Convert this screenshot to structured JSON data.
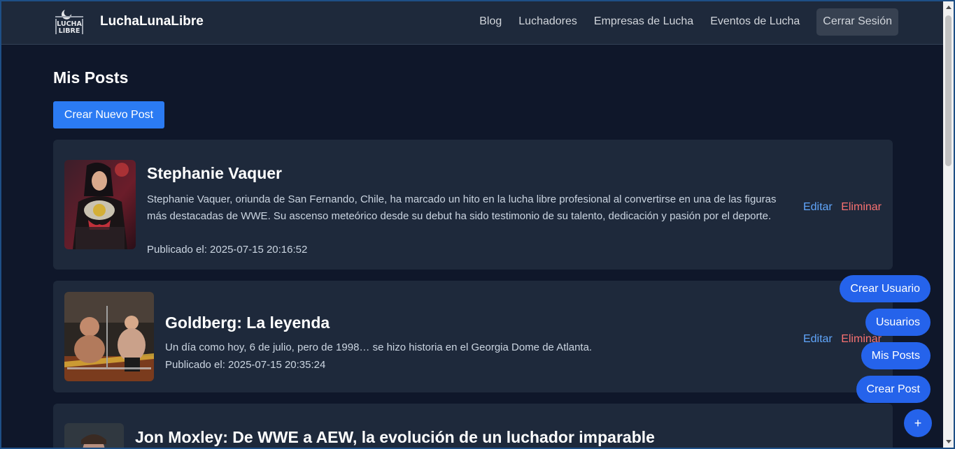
{
  "header": {
    "brand": "LuchaLunaLibre",
    "logo_text_top": "LUCHA",
    "logo_text_bottom": "LIBRE",
    "nav": [
      "Blog",
      "Luchadores",
      "Empresas de Lucha",
      "Eventos de Lucha"
    ],
    "logout": "Cerrar Sesión"
  },
  "main": {
    "title": "Mis Posts",
    "create_button": "Crear Nuevo Post",
    "posts": [
      {
        "title": "Stephanie Vaquer",
        "description": "Stephanie Vaquer, oriunda de San Fernando, Chile, ha marcado un hito en la lucha libre profesional al convertirse en una de las figuras más destacadas de WWE. Su ascenso meteórico desde su debut ha sido testimonio de su talento, dedicación y pasión por el deporte.",
        "date": "Publicado el: 2025-07-15 20:16:52",
        "edit": "Editar",
        "delete": "Eliminar"
      },
      {
        "title": "Goldberg: La leyenda",
        "description": "Un día como hoy, 6 de julio, pero de 1998… se hizo historia en el Georgia Dome de Atlanta.",
        "date": "Publicado el: 2025-07-15 20:35:24",
        "edit": "Editar",
        "delete": "Eliminar"
      },
      {
        "title": "Jon Moxley: De WWE a AEW, la evolución de un luchador imparable"
      }
    ]
  },
  "floating_menu": [
    "Crear Usuario",
    "Usuarios",
    "Mis Posts",
    "Crear Post"
  ],
  "floating_toggle": "+",
  "colors": {
    "background": "#0f172a",
    "card": "#1e293b",
    "primary": "#2563eb",
    "edit": "#60a5fa",
    "delete": "#f87171"
  }
}
